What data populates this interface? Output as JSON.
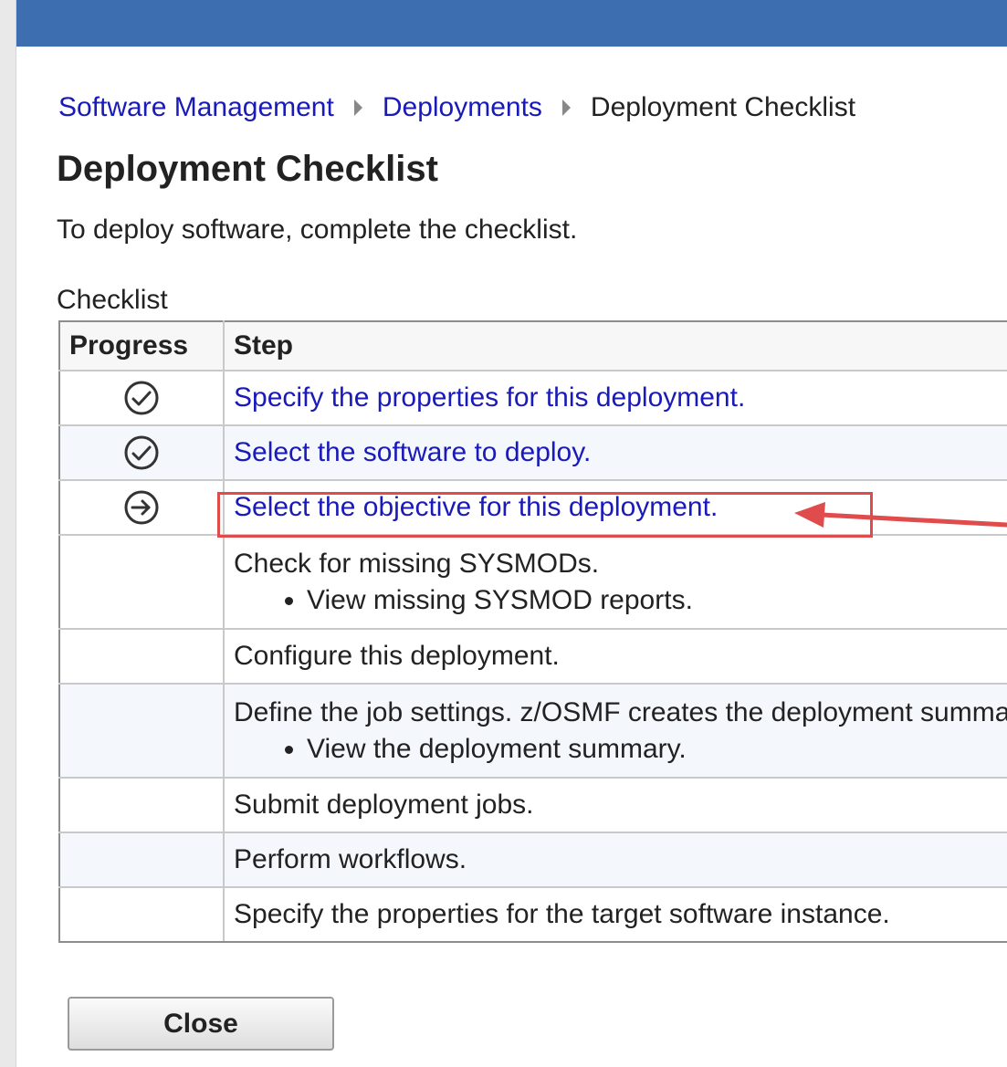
{
  "breadcrumb": {
    "items": [
      {
        "label": "Software Management"
      },
      {
        "label": "Deployments"
      },
      {
        "label": "Deployment Checklist"
      }
    ]
  },
  "page": {
    "title": "Deployment Checklist",
    "intro": "To deploy software, complete the checklist."
  },
  "checklist": {
    "caption": "Checklist",
    "columns": [
      "Progress",
      "Step"
    ],
    "rows": [
      {
        "status": "complete-icon",
        "step": "Specify the properties for this deployment."
      },
      {
        "status": "complete-icon",
        "step": "Select the software to deploy."
      },
      {
        "status": "current-step-icon",
        "step": "Select the objective for this deployment."
      },
      {
        "status": "",
        "step": "Check for missing SYSMODs.",
        "sub": "View missing SYSMOD reports."
      },
      {
        "status": "",
        "step": "Configure this deployment."
      },
      {
        "status": "",
        "step": "Define the job settings. z/OSMF creates the deployment summary and jobs.",
        "sub": "View the deployment summary."
      },
      {
        "status": "",
        "step": "Submit deployment jobs."
      },
      {
        "status": "",
        "step": "Perform workflows."
      },
      {
        "status": "",
        "step": "Specify the properties for the target software instance."
      }
    ]
  },
  "annotation": {
    "color": "#e04c4c"
  },
  "actions": {
    "close_label": "Close"
  },
  "colors": {
    "header_bar": "#3d6eb0",
    "link": "#1a1ab8"
  }
}
